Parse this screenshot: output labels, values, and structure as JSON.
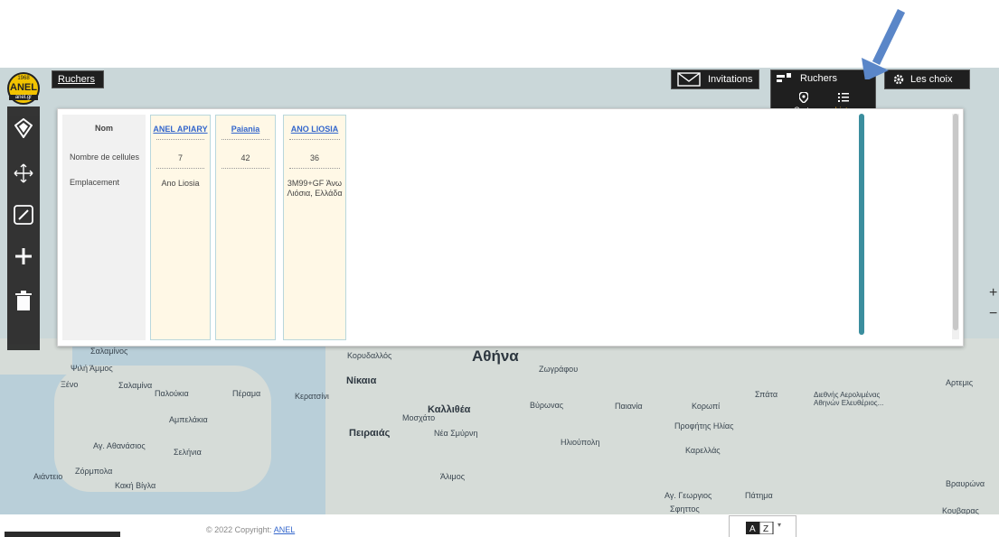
{
  "header": {
    "ruchers_tab": "Ruchers",
    "invitations_label": "Invitations",
    "ruchers_menu": {
      "title": "Ruchers",
      "options": [
        {
          "label": "Carte",
          "active": false
        },
        {
          "label": "Liste",
          "active": true
        }
      ]
    },
    "choices_label": "Les choix"
  },
  "logo": {
    "year": "1968",
    "name": "ANEL",
    "sub": "anel.gr"
  },
  "table": {
    "row_labels": [
      "Nom",
      "Nombre de cellules",
      "Emplacement"
    ],
    "apiaries": [
      {
        "name": "ANEL APIARY",
        "cells": "7",
        "location": "Ano Liosia"
      },
      {
        "name": "Paiania",
        "cells": "42",
        "location": ""
      },
      {
        "name": "ANO LIOSIA",
        "cells": "36",
        "location": "3M99+GF Άνω Λιόσια, Ελλάδα"
      }
    ]
  },
  "map": {
    "labels": {
      "athens": "Αθήνα",
      "nikaia": "Νίκαια",
      "peiraias": "Πειραιάς",
      "kallithea": "Καλλιθέα",
      "korydallos": "Κορυδαλλός",
      "moschato": "Μοσχάτο",
      "nea_smyrni": "Νέα Σμύρνη",
      "ilioupoli": "Ηλιούπολη",
      "alimos": "Άλιμος",
      "zografou": "Ζωγράφου",
      "vyronas": "Βύρωνας",
      "salamina": "Σαλαμίνα",
      "paloukia": "Παλούκια",
      "perama": "Πέραμα",
      "keratsini": "Κερατσίνι",
      "ampelakia": "Αμπελάκια",
      "ag_athanasios": "Αγ. Αθανάσιος",
      "selinia": "Σελήνια",
      "zoumpola": "Ζόρμπολα",
      "kaki_vigla": "Κακή Βίγλα",
      "aianteio": "Αιάντειο",
      "xeno": "Ξένο",
      "psili_ammos": "Ψιλή Άμμος",
      "salaminas_label": "Σαλαμίνος",
      "spata": "Σπάτα",
      "koropi": "Κορωπί",
      "paiania": "Παιανία",
      "profitis_ilias": "Προφήτης Ηλίας",
      "karellas": "Καρελλάς",
      "artemis": "Αρτεμις",
      "vravrona": "Βραυρώνα",
      "ag_georgios": "Αγ. Γεωργιος",
      "patima": "Πάτημα",
      "sfittos": "Σφηττος",
      "kouvaras": "Κουβαρας",
      "airport": "Διεθνής Αερολιμένας Αθηνών Ελευθέριος..."
    },
    "zoom_in": "+",
    "zoom_out": "−"
  },
  "footer": {
    "copyright": "© 2022 Copyright: ",
    "copyright_link": "ANEL"
  }
}
